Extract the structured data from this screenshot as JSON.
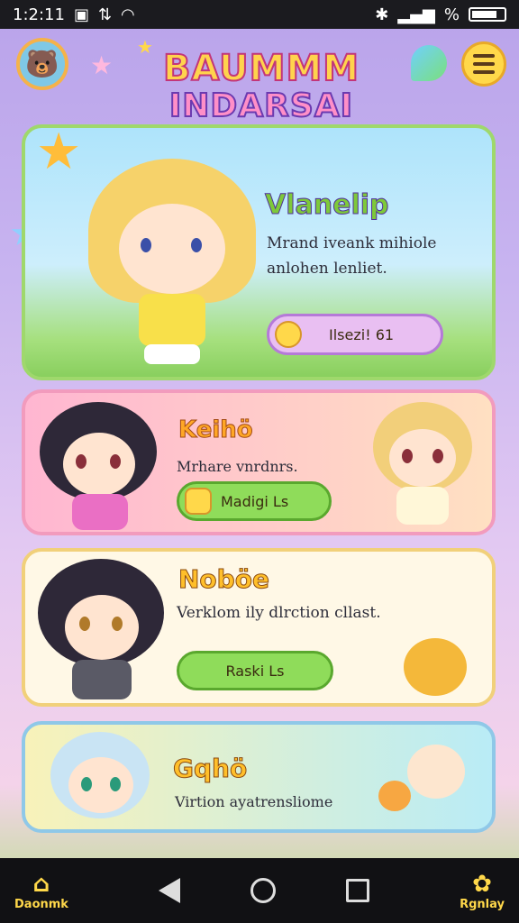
{
  "status_bar": {
    "time": "1:2:11",
    "battery": "%"
  },
  "logo": {
    "line1": "BAUMMM",
    "line2": "INDARSAI"
  },
  "characters": [
    {
      "name": "Vlanelip",
      "description_line1": "Mrand iveank mihiole",
      "description_line2": "anlohen lenliet.",
      "button_label": "Ilsezi! 61"
    },
    {
      "name": "Keihö",
      "description": "Mrhare vnrdnrs.",
      "button_label": "Madigi Ls"
    },
    {
      "name": "Noböe",
      "description": "Verklom ily dlrction cllast.",
      "button_label": "Raski Ls"
    },
    {
      "name": "Gqhö",
      "description": "Virtion ayatrensliome"
    }
  ],
  "nav": {
    "left_label": "Daonmk",
    "right_label": "Rgnlay"
  },
  "colors": {
    "accent": "#ffd84a",
    "primary_purple": "#b9a3ea",
    "green": "#8fdc5a"
  }
}
